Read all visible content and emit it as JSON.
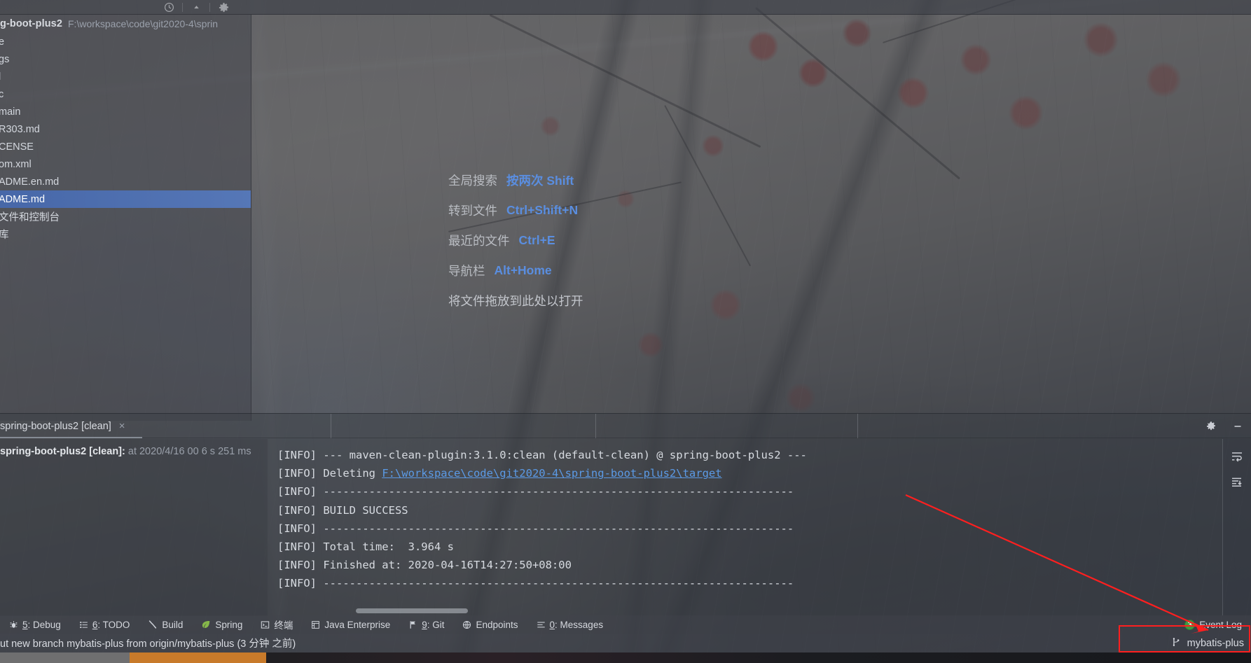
{
  "window": {
    "top_icons": [
      "clock-icon",
      "chevron-up-icon",
      "gear-icon"
    ]
  },
  "sidebar": {
    "project_name": "g-boot-plus2",
    "project_path": "F:\\workspace\\code\\git2020-4\\sprin",
    "items": [
      {
        "label": "e",
        "selected": false
      },
      {
        "label": "gs",
        "selected": false
      },
      {
        "label": "l",
        "selected": false
      },
      {
        "label": "c",
        "selected": false
      },
      {
        "label": " main",
        "selected": false
      },
      {
        "label": "R303.md",
        "selected": false
      },
      {
        "label": "CENSE",
        "selected": false
      },
      {
        "label": "om.xml",
        "selected": false
      },
      {
        "label": "ADME.en.md",
        "selected": false
      },
      {
        "label": "ADME.md",
        "selected": true
      },
      {
        "label": "文件和控制台",
        "selected": false
      },
      {
        "label": "库",
        "selected": false
      }
    ]
  },
  "editor_hints": [
    {
      "label": "全局搜索",
      "key": "按两次 Shift"
    },
    {
      "label": "转到文件",
      "key": "Ctrl+Shift+N"
    },
    {
      "label": "最近的文件",
      "key": "Ctrl+E"
    },
    {
      "label": "导航栏",
      "key": "Alt+Home"
    },
    {
      "label": "将文件拖放到此处以打开",
      "key": ""
    }
  ],
  "run_window": {
    "tab_label": "spring-boot-plus2 [clean]",
    "tab_close": "×",
    "summary_name": "spring-boot-plus2 [clean]:",
    "summary_meta": "at 2020/4/16 00",
    "summary_duration": "6 s 251 ms",
    "right_icons": [
      "gear-icon",
      "minimize-icon"
    ],
    "side_icons": [
      "soft-wrap-icon",
      "scroll-to-end-icon"
    ],
    "console_lines": [
      {
        "text": "[INFO] --- maven-clean-plugin:3.1.0:clean (default-clean) @ spring-boot-plus2 ---",
        "link": ""
      },
      {
        "text": "[INFO] Deleting ",
        "link": "F:\\workspace\\code\\git2020-4\\spring-boot-plus2\\target"
      },
      {
        "text": "[INFO] ------------------------------------------------------------------------",
        "link": ""
      },
      {
        "text": "[INFO] BUILD SUCCESS",
        "link": ""
      },
      {
        "text": "[INFO] ------------------------------------------------------------------------",
        "link": ""
      },
      {
        "text": "[INFO] Total time:  3.964 s",
        "link": ""
      },
      {
        "text": "[INFO] Finished at: 2020-04-16T14:27:50+08:00",
        "link": ""
      },
      {
        "text": "[INFO] ------------------------------------------------------------------------",
        "link": ""
      }
    ]
  },
  "toolstrip": {
    "items": [
      {
        "num": "5",
        "label": ": Debug",
        "icon": "bug-icon"
      },
      {
        "num": "6",
        "label": ": TODO",
        "icon": "list-icon"
      },
      {
        "num": "",
        "label": "Build",
        "icon": "hammer-icon"
      },
      {
        "num": "",
        "label": "Spring",
        "icon": "leaf-icon"
      },
      {
        "num": "",
        "label": "终端",
        "icon": "terminal-icon"
      },
      {
        "num": "",
        "label": "Java Enterprise",
        "icon": "enterprise-icon"
      },
      {
        "num": "9",
        "label": ": Git",
        "icon": "branch-flag-icon"
      },
      {
        "num": "",
        "label": "Endpoints",
        "icon": "globe-icon"
      },
      {
        "num": "0",
        "label": ": Messages",
        "icon": "messages-icon"
      }
    ],
    "event_log": {
      "label": "Event Log",
      "badge": "3",
      "icon": "event-log-icon"
    }
  },
  "statusbar": {
    "message": "ut new branch mybatis-plus from origin/mybatis-plus (3 分钟 之前)",
    "branch": {
      "label": "mybatis-plus",
      "icon": "git-branch-icon"
    }
  },
  "annotation": {
    "color": "#ff1f1f",
    "type": "red-rectangle-and-arrow",
    "target": "mybatis-plus"
  },
  "colors": {
    "accent_blue": "#5a8ee0",
    "selection_blue": "#4669af",
    "link_blue": "#5b9ae6",
    "badge_green": "#3f9a43",
    "annotation_red": "#ff1f1f",
    "text_primary": "#d9dce2",
    "text_muted": "#9aa0ab"
  }
}
